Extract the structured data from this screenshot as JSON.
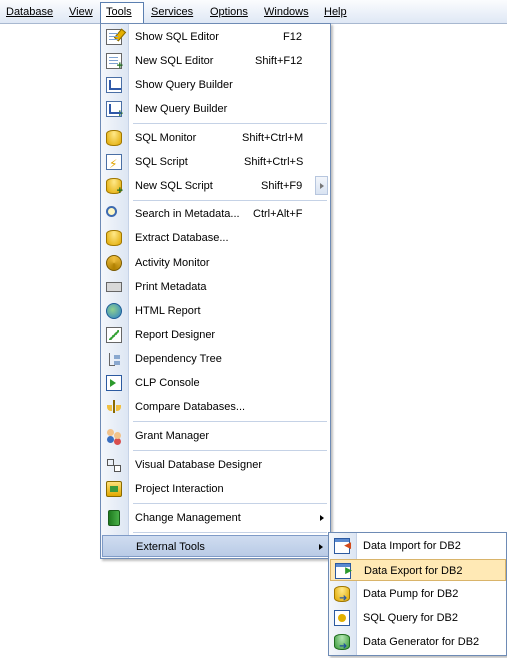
{
  "menubar": {
    "database": "Database",
    "view": "View",
    "tools": "Tools",
    "services": "Services",
    "options": "Options",
    "windows": "Windows",
    "help": "Help"
  },
  "tools_menu": {
    "show_sql_editor": {
      "label": "Show SQL Editor",
      "shortcut": "F12"
    },
    "new_sql_editor": {
      "label": "New SQL Editor",
      "shortcut": "Shift+F12"
    },
    "show_query_builder": {
      "label": "Show Query Builder"
    },
    "new_query_builder": {
      "label": "New Query Builder"
    },
    "sql_monitor": {
      "label": "SQL Monitor",
      "shortcut": "Shift+Ctrl+M"
    },
    "sql_script": {
      "label": "SQL Script",
      "shortcut": "Shift+Ctrl+S"
    },
    "new_sql_script": {
      "label": "New SQL Script",
      "shortcut": "Shift+F9"
    },
    "search_metadata": {
      "label": "Search in Metadata...",
      "shortcut": "Ctrl+Alt+F"
    },
    "extract_database": {
      "label": "Extract Database..."
    },
    "activity_monitor": {
      "label": "Activity Monitor"
    },
    "print_metadata": {
      "label": "Print Metadata"
    },
    "html_report": {
      "label": "HTML Report"
    },
    "report_designer": {
      "label": "Report Designer"
    },
    "dependency_tree": {
      "label": "Dependency Tree"
    },
    "clp_console": {
      "label": "CLP Console"
    },
    "compare_databases": {
      "label": "Compare Databases..."
    },
    "grant_manager": {
      "label": "Grant Manager"
    },
    "visual_database_designer": {
      "label": "Visual Database Designer"
    },
    "project_interaction": {
      "label": "Project Interaction"
    },
    "change_management": {
      "label": "Change Management"
    },
    "external_tools": {
      "label": "External Tools"
    }
  },
  "external_tools_menu": {
    "data_import": "Data Import for DB2",
    "data_export": "Data Export for DB2",
    "data_pump": "Data Pump for DB2",
    "sql_query": "SQL Query for DB2",
    "data_generator": "Data Generator for DB2"
  },
  "colors": {
    "highlight": "#ffe9b5",
    "selected_parent": "#b9cbe6",
    "menu_border": "#6e8bb5"
  }
}
